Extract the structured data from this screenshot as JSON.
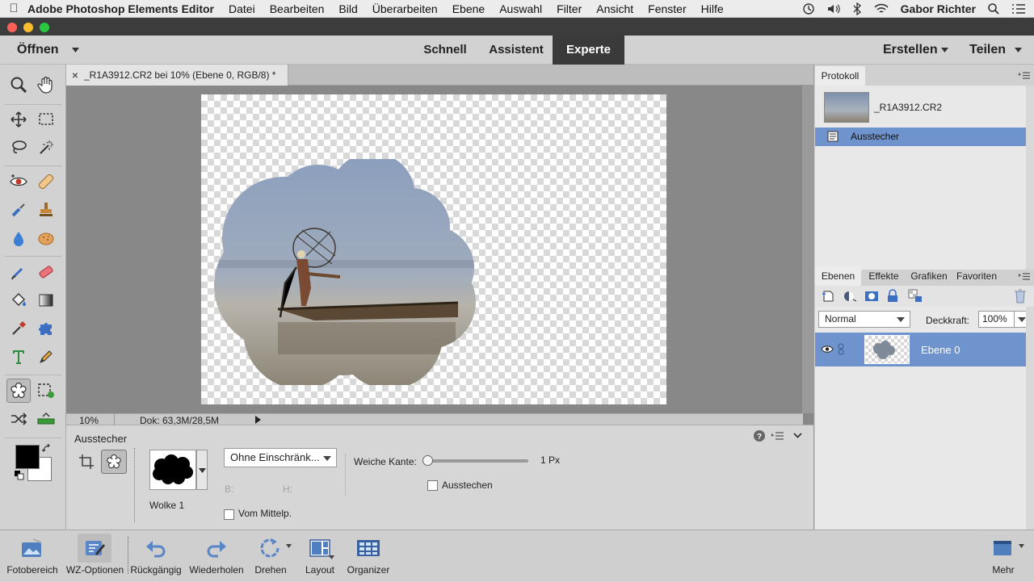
{
  "menubar": {
    "app_name": "Adobe Photoshop Elements Editor",
    "items": [
      "Datei",
      "Bearbeiten",
      "Bild",
      "Überarbeiten",
      "Ebene",
      "Auswahl",
      "Filter",
      "Ansicht",
      "Fenster",
      "Hilfe"
    ],
    "user": "Gabor Richter"
  },
  "modebar": {
    "open_label": "Öffnen",
    "tabs": [
      "Schnell",
      "Assistent",
      "Experte"
    ],
    "active_tab": "Experte",
    "create_label": "Erstellen",
    "share_label": "Teilen"
  },
  "document": {
    "tab_title": "_R1A3912.CR2 bei 10% (Ebene 0, RGB/8) *",
    "close_glyph": "×",
    "zoom": "10%",
    "doc_size": "Dok: 63,3M/28,5M"
  },
  "options": {
    "tool_name": "Ausstecher",
    "shape_name": "Wolke 1",
    "constraint_value": "Ohne Einschränk...",
    "width_label": "B:",
    "height_label": "H:",
    "from_center_label": "Vom Mittelp.",
    "feather_label": "Weiche Kante:",
    "feather_value": "1 Px",
    "feather_fraction": 0.0,
    "crop_label": "Ausstechen"
  },
  "history": {
    "tab": "Protokoll",
    "file_name": "_R1A3912.CR2",
    "step": "Ausstecher"
  },
  "layers": {
    "tabs": [
      "Ebenen",
      "Effekte",
      "Grafiken",
      "Favoriten"
    ],
    "active_tab": "Ebenen",
    "blend_mode": "Normal",
    "opacity_label": "Deckkraft:",
    "opacity_value": "100%",
    "layer_name": "Ebene 0"
  },
  "taskbar": {
    "items": [
      "Fotobereich",
      "WZ-Optionen",
      "Rückgängig",
      "Wiederholen",
      "Drehen",
      "Layout",
      "Organizer"
    ],
    "more_label": "Mehr"
  },
  "colors": {
    "selection_blue": "#6f93cd",
    "dark_tab": "#3a3a3a",
    "canvas_bg": "#888888"
  }
}
